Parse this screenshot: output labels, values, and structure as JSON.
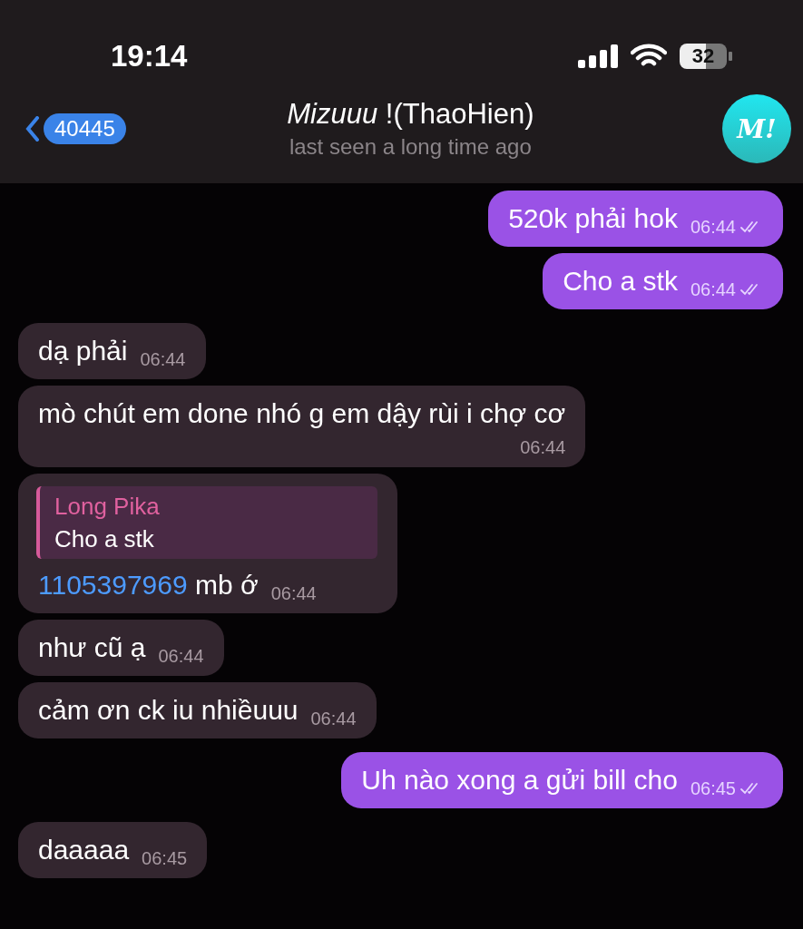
{
  "status_bar": {
    "time": "19:14",
    "battery": "32"
  },
  "header": {
    "back_badge": "40445",
    "title": "*Mizuuu* !(ThaoHien)",
    "subtitle": "last seen a long time ago",
    "avatar": "M!"
  },
  "messages": [
    {
      "kind": "outgoing",
      "text": "520k phải hok",
      "time": "06:44",
      "read": true
    },
    {
      "kind": "outgoing",
      "text": "Cho a stk",
      "time": "06:44",
      "read": true
    },
    {
      "kind": "incoming",
      "text": "dạ phải",
      "time": "06:44"
    },
    {
      "kind": "incoming",
      "text": "mò chút em done nhó g em dậy rùi i chợ cơ",
      "time": "06:44"
    },
    {
      "kind": "incoming",
      "reply": {
        "author": "Long Pika",
        "text": "Cho a stk"
      },
      "link": "1105397969",
      "text": "mb ớ",
      "time": "06:44"
    },
    {
      "kind": "incoming",
      "text": "như cũ ạ",
      "time": "06:44"
    },
    {
      "kind": "incoming",
      "text": "cảm ơn ck iu nhiềuuu",
      "time": "06:44"
    },
    {
      "kind": "outgoing",
      "text": "Uh nào xong a gửi bill cho",
      "time": "06:45",
      "read": true
    },
    {
      "kind": "incoming",
      "text": "daaaaa",
      "time": "06:45"
    }
  ]
}
